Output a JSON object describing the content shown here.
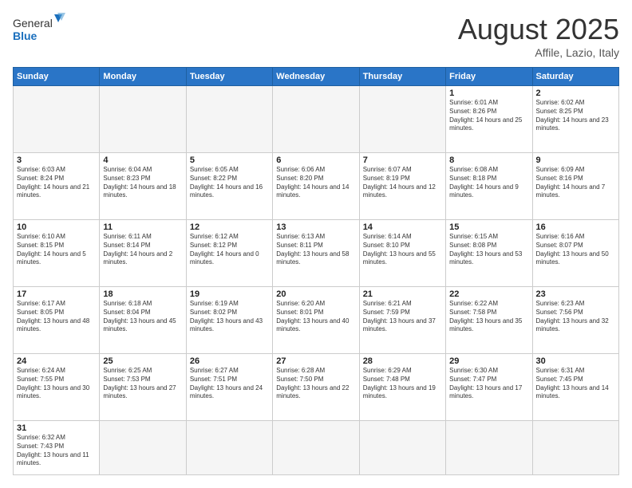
{
  "logo": {
    "text_general": "General",
    "text_blue": "Blue"
  },
  "title": {
    "month": "August 2025",
    "location": "Affile, Lazio, Italy"
  },
  "days_header": [
    "Sunday",
    "Monday",
    "Tuesday",
    "Wednesday",
    "Thursday",
    "Friday",
    "Saturday"
  ],
  "weeks": [
    [
      {
        "day": "",
        "info": ""
      },
      {
        "day": "",
        "info": ""
      },
      {
        "day": "",
        "info": ""
      },
      {
        "day": "",
        "info": ""
      },
      {
        "day": "",
        "info": ""
      },
      {
        "day": "1",
        "info": "Sunrise: 6:01 AM\nSunset: 8:26 PM\nDaylight: 14 hours and 25 minutes."
      },
      {
        "day": "2",
        "info": "Sunrise: 6:02 AM\nSunset: 8:25 PM\nDaylight: 14 hours and 23 minutes."
      }
    ],
    [
      {
        "day": "3",
        "info": "Sunrise: 6:03 AM\nSunset: 8:24 PM\nDaylight: 14 hours and 21 minutes."
      },
      {
        "day": "4",
        "info": "Sunrise: 6:04 AM\nSunset: 8:23 PM\nDaylight: 14 hours and 18 minutes."
      },
      {
        "day": "5",
        "info": "Sunrise: 6:05 AM\nSunset: 8:22 PM\nDaylight: 14 hours and 16 minutes."
      },
      {
        "day": "6",
        "info": "Sunrise: 6:06 AM\nSunset: 8:20 PM\nDaylight: 14 hours and 14 minutes."
      },
      {
        "day": "7",
        "info": "Sunrise: 6:07 AM\nSunset: 8:19 PM\nDaylight: 14 hours and 12 minutes."
      },
      {
        "day": "8",
        "info": "Sunrise: 6:08 AM\nSunset: 8:18 PM\nDaylight: 14 hours and 9 minutes."
      },
      {
        "day": "9",
        "info": "Sunrise: 6:09 AM\nSunset: 8:16 PM\nDaylight: 14 hours and 7 minutes."
      }
    ],
    [
      {
        "day": "10",
        "info": "Sunrise: 6:10 AM\nSunset: 8:15 PM\nDaylight: 14 hours and 5 minutes."
      },
      {
        "day": "11",
        "info": "Sunrise: 6:11 AM\nSunset: 8:14 PM\nDaylight: 14 hours and 2 minutes."
      },
      {
        "day": "12",
        "info": "Sunrise: 6:12 AM\nSunset: 8:12 PM\nDaylight: 14 hours and 0 minutes."
      },
      {
        "day": "13",
        "info": "Sunrise: 6:13 AM\nSunset: 8:11 PM\nDaylight: 13 hours and 58 minutes."
      },
      {
        "day": "14",
        "info": "Sunrise: 6:14 AM\nSunset: 8:10 PM\nDaylight: 13 hours and 55 minutes."
      },
      {
        "day": "15",
        "info": "Sunrise: 6:15 AM\nSunset: 8:08 PM\nDaylight: 13 hours and 53 minutes."
      },
      {
        "day": "16",
        "info": "Sunrise: 6:16 AM\nSunset: 8:07 PM\nDaylight: 13 hours and 50 minutes."
      }
    ],
    [
      {
        "day": "17",
        "info": "Sunrise: 6:17 AM\nSunset: 8:05 PM\nDaylight: 13 hours and 48 minutes."
      },
      {
        "day": "18",
        "info": "Sunrise: 6:18 AM\nSunset: 8:04 PM\nDaylight: 13 hours and 45 minutes."
      },
      {
        "day": "19",
        "info": "Sunrise: 6:19 AM\nSunset: 8:02 PM\nDaylight: 13 hours and 43 minutes."
      },
      {
        "day": "20",
        "info": "Sunrise: 6:20 AM\nSunset: 8:01 PM\nDaylight: 13 hours and 40 minutes."
      },
      {
        "day": "21",
        "info": "Sunrise: 6:21 AM\nSunset: 7:59 PM\nDaylight: 13 hours and 37 minutes."
      },
      {
        "day": "22",
        "info": "Sunrise: 6:22 AM\nSunset: 7:58 PM\nDaylight: 13 hours and 35 minutes."
      },
      {
        "day": "23",
        "info": "Sunrise: 6:23 AM\nSunset: 7:56 PM\nDaylight: 13 hours and 32 minutes."
      }
    ],
    [
      {
        "day": "24",
        "info": "Sunrise: 6:24 AM\nSunset: 7:55 PM\nDaylight: 13 hours and 30 minutes."
      },
      {
        "day": "25",
        "info": "Sunrise: 6:25 AM\nSunset: 7:53 PM\nDaylight: 13 hours and 27 minutes."
      },
      {
        "day": "26",
        "info": "Sunrise: 6:27 AM\nSunset: 7:51 PM\nDaylight: 13 hours and 24 minutes."
      },
      {
        "day": "27",
        "info": "Sunrise: 6:28 AM\nSunset: 7:50 PM\nDaylight: 13 hours and 22 minutes."
      },
      {
        "day": "28",
        "info": "Sunrise: 6:29 AM\nSunset: 7:48 PM\nDaylight: 13 hours and 19 minutes."
      },
      {
        "day": "29",
        "info": "Sunrise: 6:30 AM\nSunset: 7:47 PM\nDaylight: 13 hours and 17 minutes."
      },
      {
        "day": "30",
        "info": "Sunrise: 6:31 AM\nSunset: 7:45 PM\nDaylight: 13 hours and 14 minutes."
      }
    ],
    [
      {
        "day": "31",
        "info": "Sunrise: 6:32 AM\nSunset: 7:43 PM\nDaylight: 13 hours and 11 minutes."
      },
      {
        "day": "",
        "info": ""
      },
      {
        "day": "",
        "info": ""
      },
      {
        "day": "",
        "info": ""
      },
      {
        "day": "",
        "info": ""
      },
      {
        "day": "",
        "info": ""
      },
      {
        "day": "",
        "info": ""
      }
    ]
  ]
}
